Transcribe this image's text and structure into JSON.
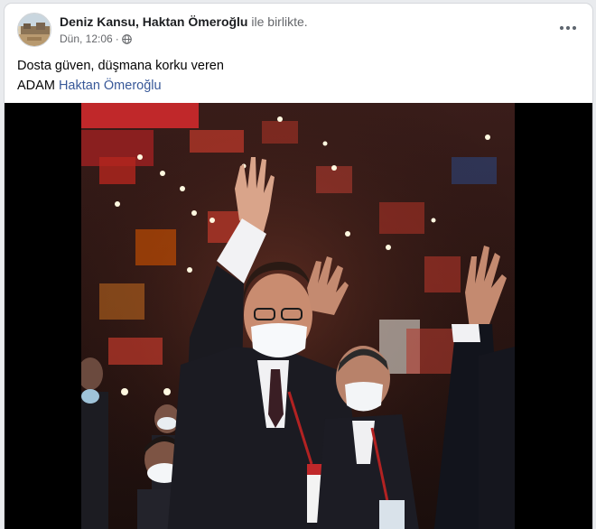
{
  "post": {
    "author": "Deniz Kansu",
    "separator": ",",
    "tagged": "Haktan Ömeroğlu",
    "with_text": "ile birlikte.",
    "time": "Dün, 12:06",
    "separator_dot": "·",
    "privacy_icon": "globe-icon",
    "more_icon": "more-horizontal-icon",
    "text_line1": "Dosta güven, düşmana korku veren",
    "text_line2_prefix": "ADAM",
    "text_line2_mention": "Haktan Ömeroğlu"
  },
  "colors": {
    "mention": "#385898",
    "secondary_text": "#65676b",
    "card_bg": "#ffffff",
    "page_bg": "#e9ebee",
    "media_bg": "#000000"
  }
}
